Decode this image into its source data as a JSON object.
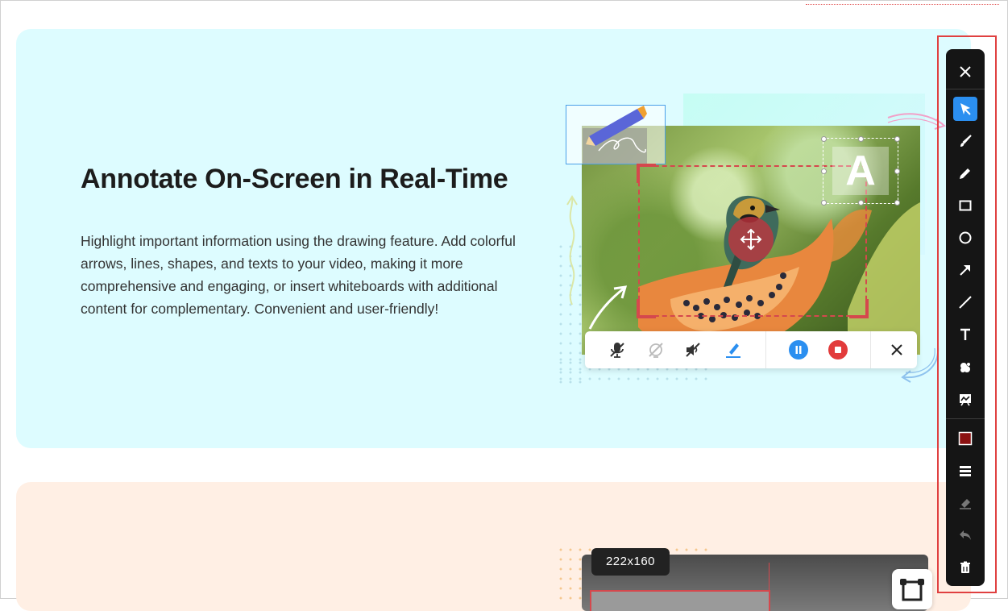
{
  "section_annotate": {
    "title": "Annotate On-Screen in Real-Time",
    "description": "Highlight important information using the drawing feature. Add colorful arrows, lines, shapes, and texts to your video, making it more comprehensive and engaging, or insert whiteboards with additional content for complementary. Convenient and user-friendly!",
    "text_box_letter": "A"
  },
  "section_second": {
    "size_badge": "222x160"
  },
  "recording_bar": {
    "items": [
      "microphone-off-icon",
      "camera-off-icon",
      "speaker-off-icon",
      "pen-icon",
      "pause-icon",
      "stop-icon",
      "close-icon"
    ]
  },
  "toolbar": {
    "tools": [
      "close-icon",
      "select-arrow-icon",
      "brush-icon",
      "pencil-icon",
      "rectangle-icon",
      "circle-icon",
      "arrow-icon",
      "line-icon",
      "text-icon",
      "fill-icon",
      "whiteboard-icon",
      "color-swatch-icon",
      "line-weight-icon",
      "eraser-icon",
      "undo-icon",
      "trash-icon"
    ],
    "active_tool": "select-arrow-icon",
    "current_color": "#8b1111"
  },
  "colors": {
    "section_bg_cyan": "#ddfcff",
    "section_bg_peach": "#ffefe4",
    "accent_blue": "#2b8ff0",
    "highlight_red": "#e04040"
  }
}
